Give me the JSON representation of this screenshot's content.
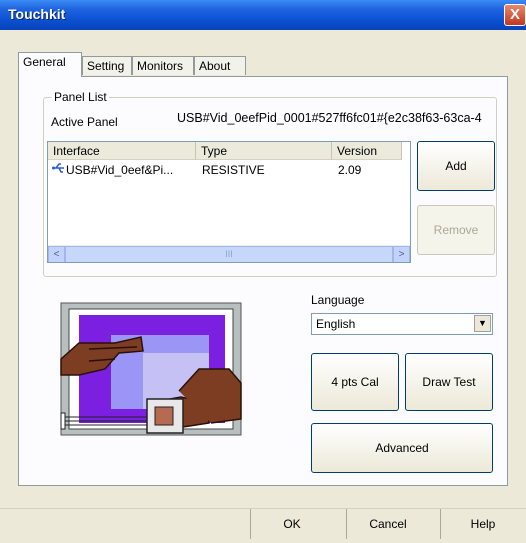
{
  "window": {
    "title": "Touchkit",
    "close_glyph": "X"
  },
  "tabs": [
    {
      "label": "General",
      "active": true
    },
    {
      "label": "Setting",
      "active": false
    },
    {
      "label": "Monitors",
      "active": false
    },
    {
      "label": "About",
      "active": false
    }
  ],
  "panel_list": {
    "legend": "Panel List",
    "active_label": "Active Panel",
    "active_value": "USB#Vid_0eefPid_0001#527ff6fc01#{e2c38f63-63ca-4",
    "columns": [
      "Interface",
      "Type",
      "Version"
    ],
    "rows": [
      {
        "interface": "USB#Vid_0eef&Pi...",
        "type": "RESISTIVE",
        "version": "2.09",
        "icon": "usb-icon"
      }
    ],
    "scroll_left": "<",
    "scroll_right": ">",
    "scroll_thumb": "III"
  },
  "buttons": {
    "add": "Add",
    "remove": "Remove",
    "cal": "4 pts Cal",
    "draw_test": "Draw Test",
    "advanced": "Advanced",
    "ok": "OK",
    "cancel": "Cancel",
    "help": "Help"
  },
  "language": {
    "label": "Language",
    "selected": "English",
    "arrow": "▼"
  },
  "colors": {
    "title_bar": "#0a4fd1",
    "panel_bg": "#fcfcfe",
    "illustration_purple": "#7b1fe0"
  }
}
